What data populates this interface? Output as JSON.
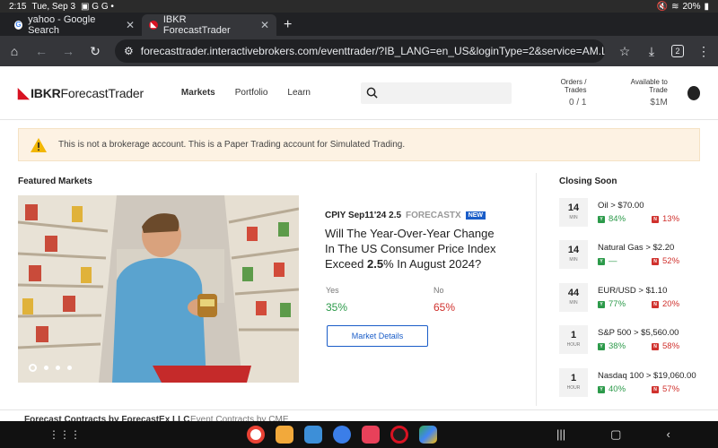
{
  "status_bar": {
    "time": "2:15",
    "date": "Tue, Sep 3",
    "battery": "20%"
  },
  "browser": {
    "tabs": [
      {
        "label": "yahoo - Google Search",
        "active": false
      },
      {
        "label": "IBKR ForecastTrader",
        "active": true
      }
    ],
    "url": "forecasttrader.interactivebrokers.com/eventtrader/?IB_LANG=en_US&loginType=2&service=AM.LOGIN&clie",
    "tab_count": "2"
  },
  "header": {
    "logo_bold": "IBKR",
    "logo_light": "ForecastTrader",
    "nav": [
      "Markets",
      "Portfolio",
      "Learn"
    ],
    "orders_label": "Orders / Trades",
    "orders_value": "0 / 1",
    "available_label": "Available to Trade",
    "available_value": "$1M"
  },
  "banner": {
    "text": "This is not a brokerage account. This is a Paper Trading account for Simulated Trading."
  },
  "featured": {
    "title": "Featured Markets",
    "code": "CPIY Sep11'24 2.5",
    "provider": "FORECASTX",
    "badge": "NEW",
    "question_pre": "Will The Year-Over-Year Change In The US Consumer Price Index Exceed ",
    "question_bold": "2.5",
    "question_post": "% In August 2024?",
    "yes_label": "Yes",
    "yes_value": "35%",
    "no_label": "No",
    "no_value": "65%",
    "details_button": "Market Details",
    "carousel_slide": 1,
    "carousel_total": 4
  },
  "closing_soon": {
    "title": "Closing Soon",
    "items": [
      {
        "time": "14",
        "unit": "MIN",
        "title": "Oil > $70.00",
        "yes": "84%",
        "no": "13%"
      },
      {
        "time": "14",
        "unit": "MIN",
        "title": "Natural Gas > $2.20",
        "yes": "—",
        "no": "52%"
      },
      {
        "time": "44",
        "unit": "MIN",
        "title": "EUR/USD > $1.10",
        "yes": "77%",
        "no": "20%"
      },
      {
        "time": "1",
        "unit": "HOUR",
        "title": "S&P 500 > $5,560.00",
        "yes": "38%",
        "no": "58%"
      },
      {
        "time": "1",
        "unit": "HOUR",
        "title": "Nasdaq 100 > $19,060.00",
        "yes": "40%",
        "no": "57%"
      }
    ]
  },
  "bottom_tabs": [
    "Forecast Contracts by ForecastEx LLC",
    "Event Contracts by CME"
  ],
  "colors": {
    "yes": "#2c9a4a",
    "no": "#d0312d",
    "accent": "#1a5dc8",
    "brand": "#d81222"
  }
}
